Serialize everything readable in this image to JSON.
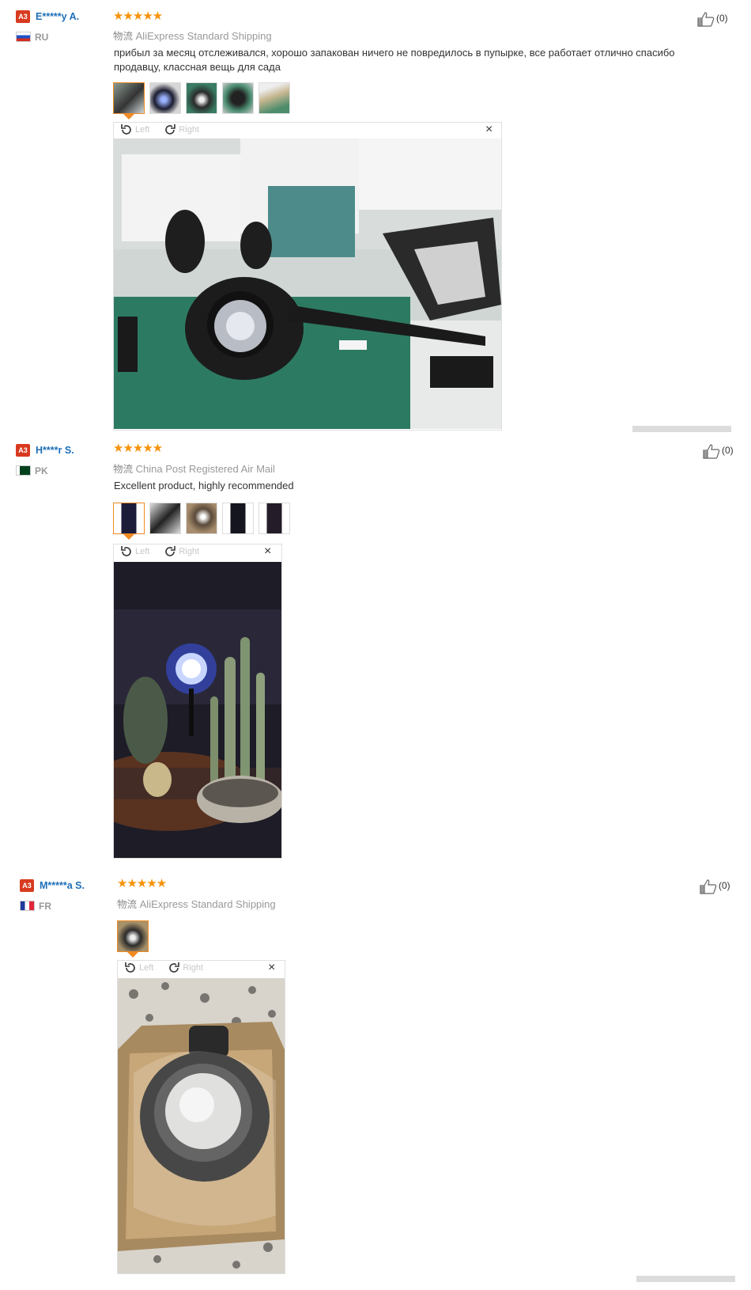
{
  "reviews": [
    {
      "badge": "A3",
      "username": "E*****y A.",
      "country": "RU",
      "stars": "★★★★★",
      "shipping_zh": "物流",
      "shipping": "AliExpress Standard Shipping",
      "text": "прибыл за месяц отслеживался, хорошо запакован ничего не повредилось в пупырке, все работает отлично спасибо продавцу, классная вещь для сада",
      "likes": "(0)",
      "thumbnails_count": 5
    },
    {
      "badge": "A3",
      "username": "H****r S.",
      "country": "PK",
      "stars": "★★★★★",
      "shipping_zh": "物流",
      "shipping": "China Post Registered Air Mail",
      "text": "Excellent product, highly recommended",
      "likes": "(0)",
      "thumbnails_count": 5
    },
    {
      "badge": "A3",
      "username": "M*****a S.",
      "country": "FR",
      "stars": "★★★★★",
      "shipping_zh": "物流",
      "shipping": "AliExpress Standard Shipping",
      "text": "",
      "likes": "(0)",
      "thumbnails_count": 1
    }
  ],
  "viewer": {
    "rotate_left": "Left",
    "rotate_right": "Right",
    "close": "×"
  }
}
